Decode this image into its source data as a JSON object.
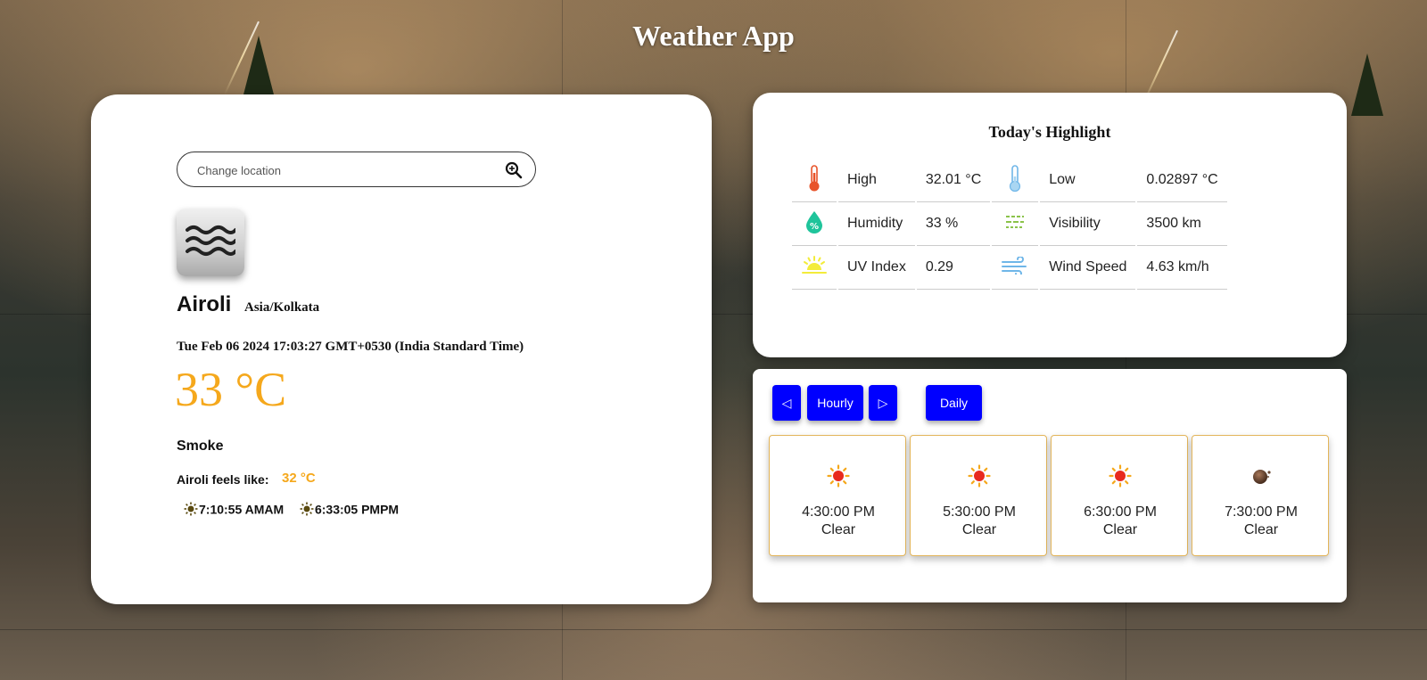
{
  "app": {
    "title": "Weather App"
  },
  "current": {
    "search_placeholder": "Change location",
    "icon": "fog-waves-icon",
    "city": "Airoli",
    "timezone": "Asia/Kolkata",
    "datetime": "Tue Feb 06 2024 17:03:27 GMT+0530 (India Standard Time)",
    "temperature": "33 °C",
    "condition": "Smoke",
    "feels_like_label": "Airoli feels like:",
    "feels_like_value": "32 °C",
    "sunrise": "7:10:55 AMAM",
    "sunset": "6:33:05 PMPM"
  },
  "highlights": {
    "title": "Today's Highlight",
    "rows": [
      {
        "left_icon": "thermometer-hot-icon",
        "left_label": "High",
        "left_value": "32.01 °C",
        "right_icon": "thermometer-cold-icon",
        "right_label": "Low",
        "right_value": "0.02897 °C"
      },
      {
        "left_icon": "humidity-drop-icon",
        "left_label": "Humidity",
        "left_value": "33 %",
        "right_icon": "visibility-icon",
        "right_label": "Visibility",
        "right_value": "3500 km"
      },
      {
        "left_icon": "uv-sunrise-icon",
        "left_label": "UV Index",
        "left_value": "0.29",
        "right_icon": "wind-icon",
        "right_label": "Wind Speed",
        "right_value": "4.63 km/h"
      }
    ]
  },
  "forecast": {
    "prev_label": "◁",
    "hourly_label": "Hourly",
    "next_label": "▷",
    "daily_label": "Daily",
    "items": [
      {
        "time": "4:30:00 PM",
        "desc": "Clear",
        "icon": "sun-icon"
      },
      {
        "time": "5:30:00 PM",
        "desc": "Clear",
        "icon": "sun-icon"
      },
      {
        "time": "6:30:00 PM",
        "desc": "Clear",
        "icon": "sun-icon"
      },
      {
        "time": "7:30:00 PM",
        "desc": "Clear",
        "icon": "moon-icon"
      }
    ]
  },
  "colors": {
    "accent": "#f5a81c",
    "button": "#0000ff",
    "card": "#ffffff"
  }
}
